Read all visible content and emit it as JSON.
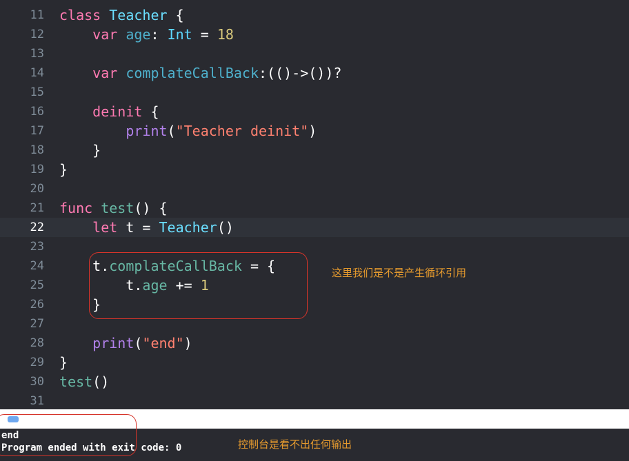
{
  "editor": {
    "lines": [
      {
        "n": "11",
        "tokens": [
          [
            "kw",
            "class"
          ],
          [
            "",
            " "
          ],
          [
            "type",
            "Teacher"
          ],
          [
            "",
            " {"
          ]
        ]
      },
      {
        "n": "12",
        "tokens": [
          [
            "",
            "    "
          ],
          [
            "kw",
            "var"
          ],
          [
            "",
            " "
          ],
          [
            "prop",
            "age"
          ],
          [
            "",
            ": "
          ],
          [
            "typeB",
            "Int"
          ],
          [
            "",
            " = "
          ],
          [
            "num",
            "18"
          ]
        ]
      },
      {
        "n": "13",
        "tokens": []
      },
      {
        "n": "14",
        "tokens": [
          [
            "",
            "    "
          ],
          [
            "kw",
            "var"
          ],
          [
            "",
            " "
          ],
          [
            "prop",
            "complateCallBack"
          ],
          [
            "",
            ":(()->())?"
          ]
        ]
      },
      {
        "n": "15",
        "tokens": []
      },
      {
        "n": "16",
        "tokens": [
          [
            "",
            "    "
          ],
          [
            "kw",
            "deinit"
          ],
          [
            "",
            " {"
          ]
        ]
      },
      {
        "n": "17",
        "tokens": [
          [
            "",
            "        "
          ],
          [
            "bi",
            "print"
          ],
          [
            "",
            "("
          ],
          [
            "str",
            "\"Teacher deinit\""
          ],
          [
            "",
            ")"
          ]
        ]
      },
      {
        "n": "18",
        "tokens": [
          [
            "",
            "    }"
          ]
        ]
      },
      {
        "n": "19",
        "tokens": [
          [
            "",
            "}"
          ]
        ]
      },
      {
        "n": "20",
        "tokens": []
      },
      {
        "n": "21",
        "tokens": [
          [
            "kw",
            "func"
          ],
          [
            "",
            " "
          ],
          [
            "fn",
            "test"
          ],
          [
            "",
            "() {"
          ]
        ]
      },
      {
        "n": "22",
        "current": true,
        "tokens": [
          [
            "",
            "    "
          ],
          [
            "kw",
            "let"
          ],
          [
            "",
            " t = "
          ],
          [
            "type",
            "Teacher"
          ],
          [
            "",
            "()"
          ]
        ]
      },
      {
        "n": "23",
        "tokens": []
      },
      {
        "n": "24",
        "tokens": [
          [
            "",
            "    t."
          ],
          [
            "member",
            "complateCallBack"
          ],
          [
            "",
            " = {"
          ]
        ]
      },
      {
        "n": "25",
        "tokens": [
          [
            "",
            "        t."
          ],
          [
            "member",
            "age"
          ],
          [
            "",
            " += "
          ],
          [
            "num",
            "1"
          ]
        ]
      },
      {
        "n": "26",
        "tokens": [
          [
            "",
            "    }"
          ]
        ]
      },
      {
        "n": "27",
        "tokens": []
      },
      {
        "n": "28",
        "tokens": [
          [
            "",
            "    "
          ],
          [
            "bi",
            "print"
          ],
          [
            "",
            "("
          ],
          [
            "str",
            "\"end\""
          ],
          [
            "",
            ")"
          ]
        ]
      },
      {
        "n": "29",
        "tokens": [
          [
            "",
            "}"
          ]
        ]
      },
      {
        "n": "30",
        "tokens": [
          [
            "fn",
            "test"
          ],
          [
            "",
            "()"
          ]
        ]
      },
      {
        "n": "31",
        "tokens": []
      }
    ]
  },
  "annotations": {
    "code_note": "这里我们是不是产生循环引用",
    "console_note": "控制台是看不出任何输出"
  },
  "console": {
    "line1": "end",
    "line2": "Program ended with exit code: 0"
  }
}
